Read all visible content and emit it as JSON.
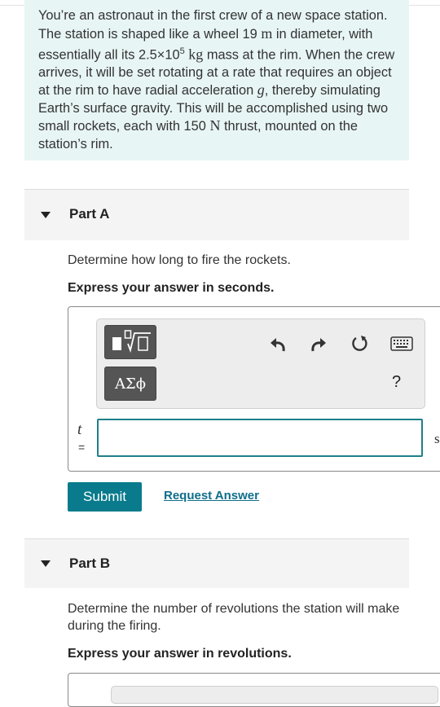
{
  "problem": {
    "intro_1": "You’re an astronaut in the first crew of a new space station. The station is shaped like a wheel 19 ",
    "unit_m": "m",
    "intro_2": " in diameter, with essentially all its 2.5×10",
    "exponent": "5",
    "space": " ",
    "unit_kg": "kg",
    "intro_3": " mass at the rim. When the crew arrives, it will be set rotating at a rate that requires an object at the rim to have radial acceleration ",
    "var_g": "g",
    "intro_4": ", thereby simulating Earth’s surface gravity. This will be accomplished using two small rockets, each with 150 ",
    "unit_N": "N",
    "intro_5": " thrust, mounted on the station’s rim."
  },
  "partA": {
    "title": "Part A",
    "question": "Determine how long to fire the rockets.",
    "instruction": "Express your answer in seconds.",
    "variable": "t",
    "equals": "=",
    "input_value": "",
    "unit": "s",
    "toolbar": {
      "template_button": "template-icon",
      "greek_label": "ΑΣϕ",
      "undo": "undo-icon",
      "redo": "redo-icon",
      "reset": "reset-icon",
      "keyboard": "keyboard-icon",
      "help_label": "?"
    },
    "submit_label": "Submit",
    "request_label": "Request Answer"
  },
  "partB": {
    "title": "Part B",
    "question": "Determine the number of revolutions the station will make during the firing.",
    "instruction": "Express your answer in revolutions."
  },
  "colors": {
    "problem_bg": "#e8f5f5",
    "accent": "#0a7b8c",
    "link": "#0f6d8a"
  }
}
